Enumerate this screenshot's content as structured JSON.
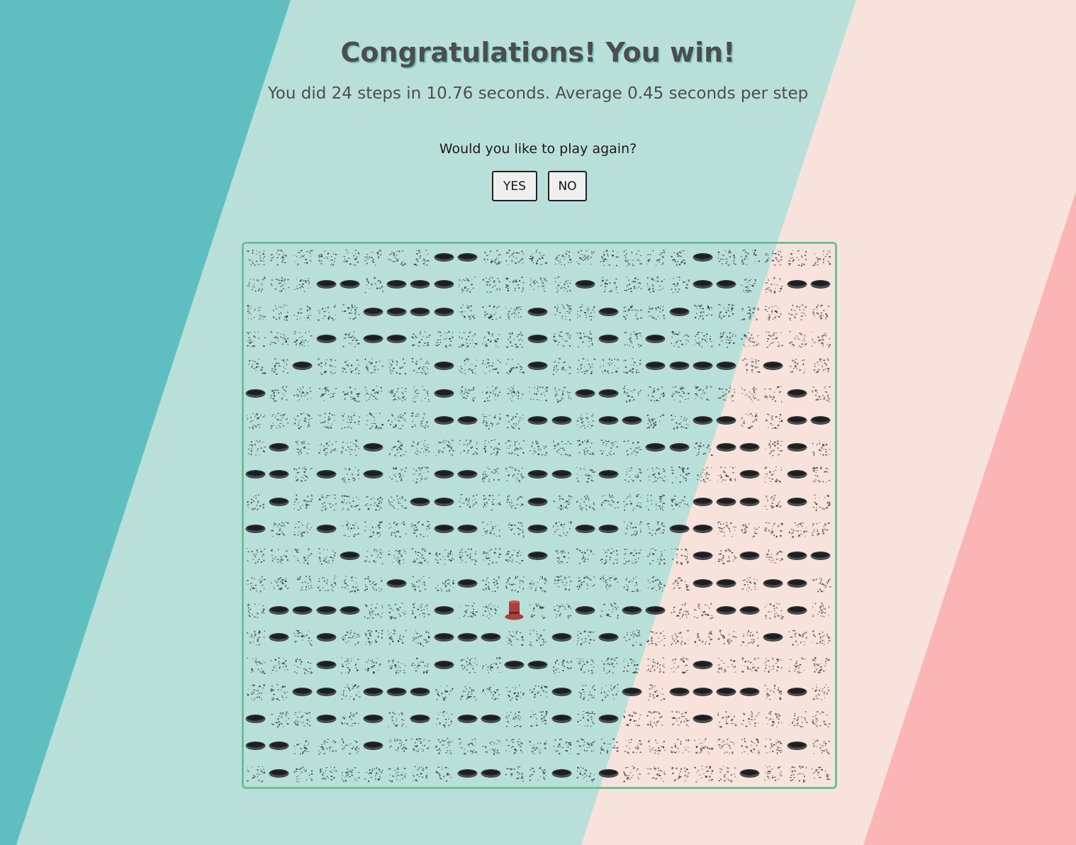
{
  "colors": {
    "teal": "#5fbfc0",
    "mint": "#b9e0d8",
    "cream": "#f7e3db",
    "pink": "#fbb5b6",
    "board_border": "#6dbf9a",
    "hole": "#36393c",
    "hat": "#a7423f"
  },
  "result": {
    "title": "Congratulations!  You win!",
    "stats": "You did 24 steps in 10.76 seconds. Average 0.45 seconds per step"
  },
  "prompt": {
    "question": "Would you like to play again?",
    "yes_label": "YES",
    "no_label": "NO"
  },
  "board": {
    "columns": 25,
    "rows": 20,
    "legend": {
      "H": "hole-icon",
      ".": "confetti-tile-icon",
      "P": "top-hat-icon"
    },
    "grid": [
      "........HH.........H.....",
      "...HH.HHH.....H....HH..HH",
      ".....HHHH...H..H..H......",
      "...H.HH.....H..H.H.......",
      "..H.....H...H....HHHH.H..",
      "H.......H.....HH.......H.",
      "........HH..HH.HH..HH..HH",
      ".H...H...........HH.HH.H.",
      "HH.H.H..HH..HH.H.....H.H.",
      ".H.....HH...H......HHH.H.",
      "H..H....HH..H.HH..HH.....",
      "....H.......H......H.H.HH",
      "......H..H.........HH.HH.",
      ".HHHH...H..P..H.HH..HH.H.",
      ".H.H....HHH..H.H......H..",
      "...H....H..HH......H.....",
      "..HH.HHH.....H..H.HHHH.H.",
      "H..H.H.H.HH..H.H...H.....",
      "HH...H.................H.",
      ".H.......HH..H.H.....H..."
    ]
  }
}
